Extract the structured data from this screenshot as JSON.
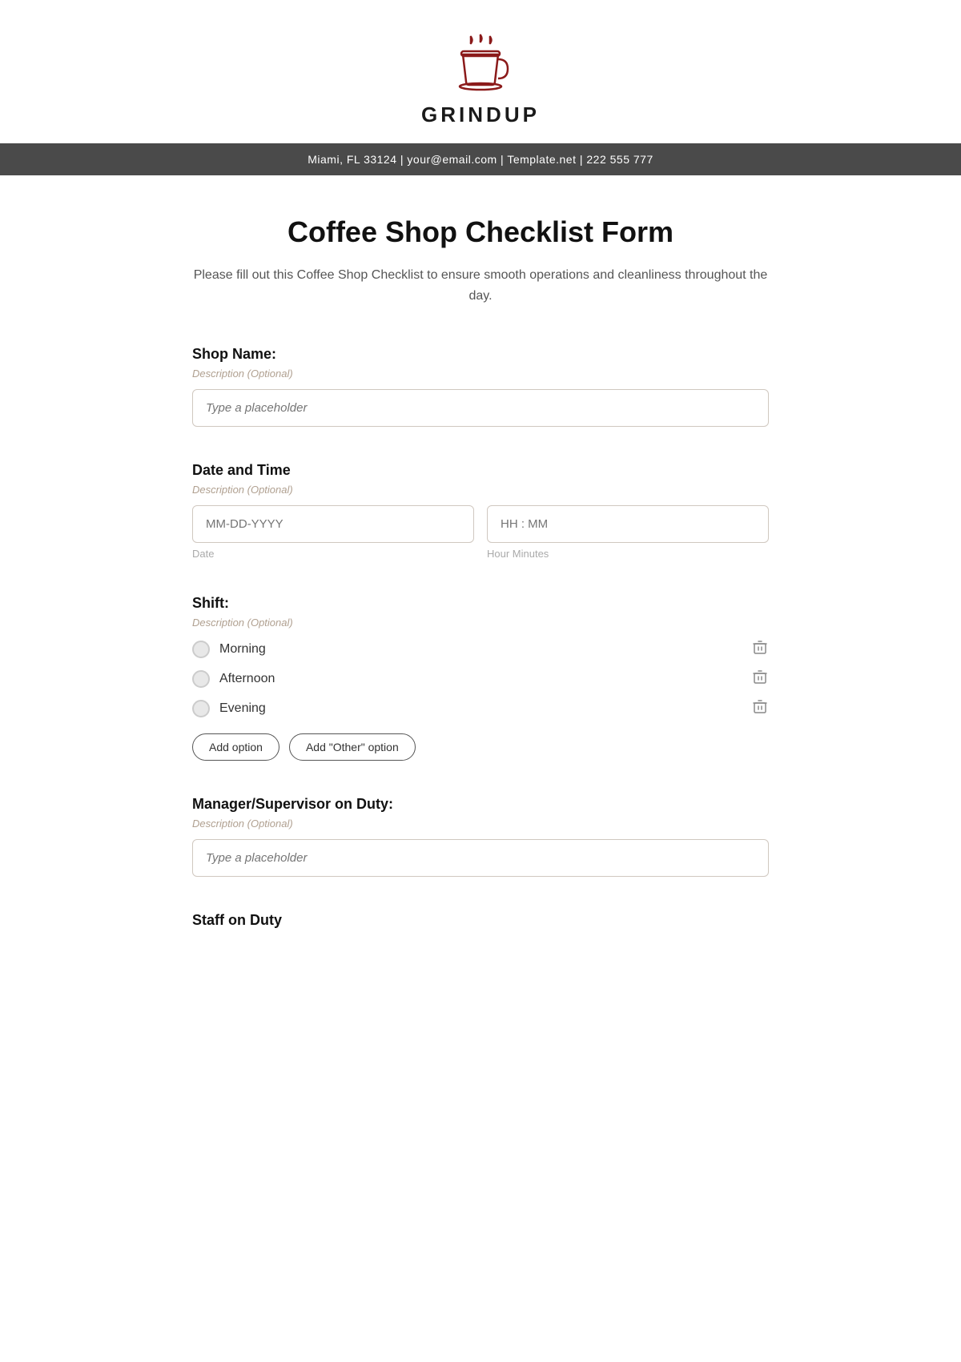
{
  "header": {
    "brand": "GRINDUP",
    "info_bar": "Miami, FL 33124 | your@email.com | Template.net | 222 555 777"
  },
  "form": {
    "title": "Coffee Shop Checklist Form",
    "description": "Please fill out this Coffee Shop Checklist to ensure smooth operations and cleanliness throughout the day.",
    "fields": [
      {
        "id": "shop-name",
        "label": "Shop Name:",
        "description": "Description (Optional)",
        "type": "text",
        "placeholder": "Type a placeholder"
      },
      {
        "id": "date-time",
        "label": "Date and Time",
        "description": "Description (Optional)",
        "type": "datetime",
        "date_placeholder": "MM-DD-YYYY",
        "time_placeholder": "HH : MM",
        "date_sublabel": "Date",
        "time_sublabel": "Hour Minutes"
      },
      {
        "id": "shift",
        "label": "Shift:",
        "description": "Description (Optional)",
        "type": "radio",
        "options": [
          "Morning",
          "Afternoon",
          "Evening"
        ],
        "add_option_label": "Add option",
        "add_other_option_label": "Add \"Other\" option"
      },
      {
        "id": "manager",
        "label": "Manager/Supervisor on Duty:",
        "description": "Description (Optional)",
        "type": "text",
        "placeholder": "Type a placeholder"
      },
      {
        "id": "staff",
        "label": "Staff on Duty",
        "description": "",
        "type": "text",
        "placeholder": ""
      }
    ]
  },
  "icons": {
    "delete": "🗑",
    "coffee_cup": "☕"
  }
}
